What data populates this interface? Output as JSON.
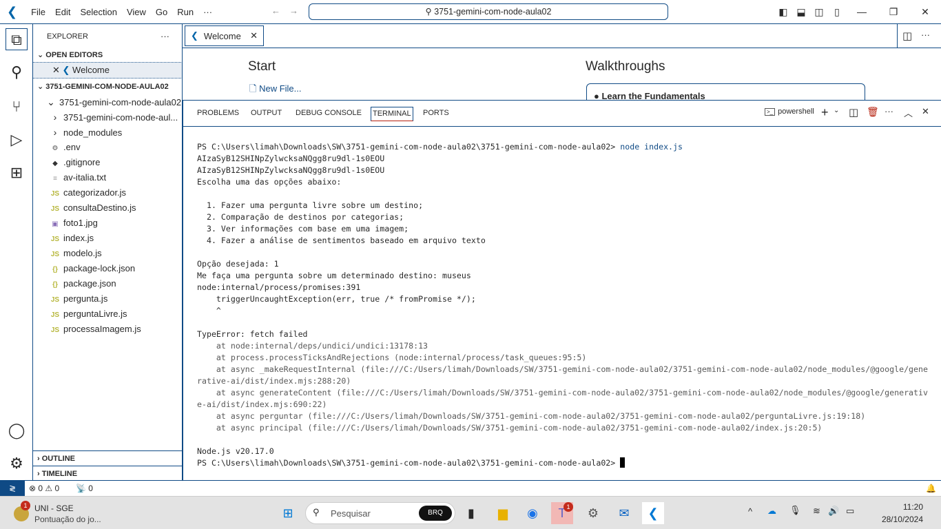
{
  "titlebar": {
    "menus": [
      "File",
      "Edit",
      "Selection",
      "View",
      "Go",
      "Run",
      "···"
    ],
    "search": "3751-gemini-com-node-aula02"
  },
  "sidebar": {
    "title": "EXPLORER",
    "more": "···",
    "open_editors": "OPEN EDITORS",
    "open_items": [
      "Welcome"
    ],
    "folder": "3751-GEMINI-COM-NODE-AULA02",
    "tree": [
      {
        "label": "3751-gemini-com-node-aula02",
        "icon": "chevron-down",
        "indent": 1
      },
      {
        "label": "3751-gemini-com-node-aul...",
        "icon": "chevron-right",
        "indent": 2
      },
      {
        "label": "node_modules",
        "icon": "chevron-right",
        "indent": 2
      },
      {
        "label": ".env",
        "icon": "gear",
        "indent": 2
      },
      {
        "label": ".gitignore",
        "icon": "git",
        "indent": 2
      },
      {
        "label": "av-italia.txt",
        "icon": "text-file",
        "indent": 2
      },
      {
        "label": "categorizador.js",
        "icon": "js",
        "indent": 2
      },
      {
        "label": "consultaDestino.js",
        "icon": "js",
        "indent": 2
      },
      {
        "label": "foto1.jpg",
        "icon": "image",
        "indent": 2
      },
      {
        "label": "index.js",
        "icon": "js",
        "indent": 2
      },
      {
        "label": "modelo.js",
        "icon": "js",
        "indent": 2
      },
      {
        "label": "package-lock.json",
        "icon": "json",
        "indent": 2
      },
      {
        "label": "package.json",
        "icon": "json",
        "indent": 2
      },
      {
        "label": "pergunta.js",
        "icon": "js",
        "indent": 2
      },
      {
        "label": "perguntaLivre.js",
        "icon": "js",
        "indent": 2
      },
      {
        "label": "processaImagem.js",
        "icon": "js",
        "indent": 2
      }
    ],
    "outline": "OUTLINE",
    "timeline": "TIMELINE"
  },
  "editor": {
    "tab": "Welcome",
    "start": "Start",
    "new_file": "New File...",
    "walkthroughs": "Walkthroughs",
    "learn": "Learn the Fundamentals"
  },
  "panel": {
    "tabs": [
      "PROBLEMS",
      "OUTPUT",
      "DEBUG CONSOLE",
      "TERMINAL",
      "PORTS"
    ],
    "active_tab": "TERMINAL",
    "shell": "powershell"
  },
  "terminal": {
    "prompt": "PS C:\\Users\\limah\\Downloads\\SW\\3751-gemini-com-node-aula02\\3751-gemini-com-node-aula02> ",
    "command": "node index.js",
    "lines": [
      "AIzaSyB12SHINpZylwcksaNQgg8ru9dl-1s0EOU",
      "AIzaSyB12SHINpZylwcksaNQgg8ru9dl-1s0EOU",
      "Escolha uma das opções abaixo:",
      "",
      "  1. Fazer uma pergunta livre sobre um destino;",
      "  2. Comparação de destinos por categorias;",
      "  3. Ver informações com base em uma imagem;",
      "  4. Fazer a análise de sentimentos baseado em arquivo texto",
      "",
      "Opção desejada: 1",
      "Me faça uma pergunta sobre um determinado destino: museus",
      "node:internal/process/promises:391",
      "    triggerUncaughtException(err, true /* fromPromise */);",
      "    ^",
      "",
      "TypeError: fetch failed",
      "    at node:internal/deps/undici/undici:13178:13",
      "    at process.processTicksAndRejections (node:internal/process/task_queues:95:5)",
      "    at async _makeRequestInternal (file:///C:/Users/limah/Downloads/SW/3751-gemini-com-node-aula02/3751-gemini-com-node-aula02/node_modules/@google/gene",
      "rative-ai/dist/index.mjs:288:20)",
      "    at async generateContent (file:///C:/Users/limah/Downloads/SW/3751-gemini-com-node-aula02/3751-gemini-com-node-aula02/node_modules/@google/generativ",
      "e-ai/dist/index.mjs:690:22)",
      "    at async perguntar (file:///C:/Users/limah/Downloads/SW/3751-gemini-com-node-aula02/3751-gemini-com-node-aula02/perguntaLivre.js:19:18)",
      "    at async principal (file:///C:/Users/limah/Downloads/SW/3751-gemini-com-node-aula02/3751-gemini-com-node-aula02/index.js:20:5)",
      "",
      "Node.js v20.17.0"
    ],
    "final_prompt": "PS C:\\Users\\limah\\Downloads\\SW\\3751-gemini-com-node-aula02\\3751-gemini-com-node-aula02> "
  },
  "status": {
    "errors": "0",
    "warnings": "0",
    "ports": "0"
  },
  "taskbar": {
    "widget_title": "UNI - SGE",
    "widget_sub": "Pontuação do jo...",
    "widget_badge": "1",
    "search": "Pesquisar",
    "teams_badge": "1",
    "time": "11:20",
    "date": "28/10/2024"
  },
  "colors": {
    "border": "#0f4a85",
    "accent": "#0f4a85",
    "trash": "#b5200d"
  }
}
